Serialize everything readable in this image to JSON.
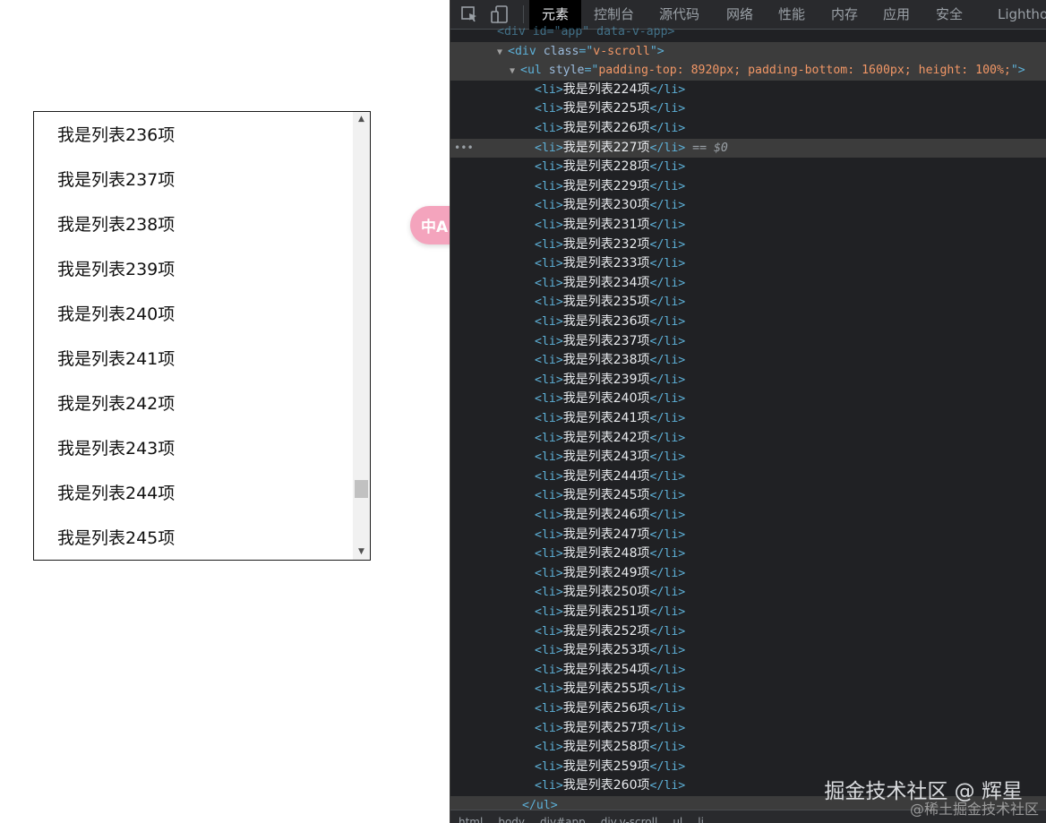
{
  "scroll_list": {
    "items": [
      "我是列表236项",
      "我是列表237项",
      "我是列表238项",
      "我是列表239项",
      "我是列表240项",
      "我是列表241项",
      "我是列表242项",
      "我是列表243项",
      "我是列表244项",
      "我是列表245项"
    ],
    "scrollbar_position": 0.82
  },
  "translate_button": {
    "label": "中A"
  },
  "devtools": {
    "tabs": [
      "元素",
      "控制台",
      "源代码",
      "网络",
      "性能",
      "内存",
      "应用",
      "安全",
      "Lighthouse"
    ],
    "active_tab": "元素",
    "dom": {
      "top_line": "<div id=\"app\" data-v-app>",
      "div_tag": "div",
      "div_class_attr": "class",
      "div_class_value": "v-scroll",
      "ul_tag": "ul",
      "ul_style_attr": "style",
      "ul_style_value": "padding-top: 8920px; padding-bottom: 1600px; height: 100%;",
      "li_items": [
        "我是列表224项",
        "我是列表225项",
        "我是列表226项",
        "我是列表227项",
        "我是列表228项",
        "我是列表229项",
        "我是列表230项",
        "我是列表231项",
        "我是列表232项",
        "我是列表233项",
        "我是列表234项",
        "我是列表235项",
        "我是列表236项",
        "我是列表237项",
        "我是列表238项",
        "我是列表239项",
        "我是列表240项",
        "我是列表241项",
        "我是列表242项",
        "我是列表243项",
        "我是列表244项",
        "我是列表245项",
        "我是列表246项",
        "我是列表247项",
        "我是列表248项",
        "我是列表249项",
        "我是列表250项",
        "我是列表251项",
        "我是列表252项",
        "我是列表253项",
        "我是列表254项",
        "我是列表255项",
        "我是列表256项",
        "我是列表257项",
        "我是列表258项",
        "我是列表259项",
        "我是列表260项"
      ],
      "selected_item": "我是列表227项",
      "selected_marker": "== $0",
      "closing_ul": "</ul>"
    },
    "breadcrumb": [
      "html",
      "body",
      "div#app",
      "div.v-scroll",
      "ul",
      "li"
    ]
  },
  "watermark": {
    "main": "掘金技术社区 @ 辉星",
    "sub": "@稀土掘金技术社区"
  }
}
